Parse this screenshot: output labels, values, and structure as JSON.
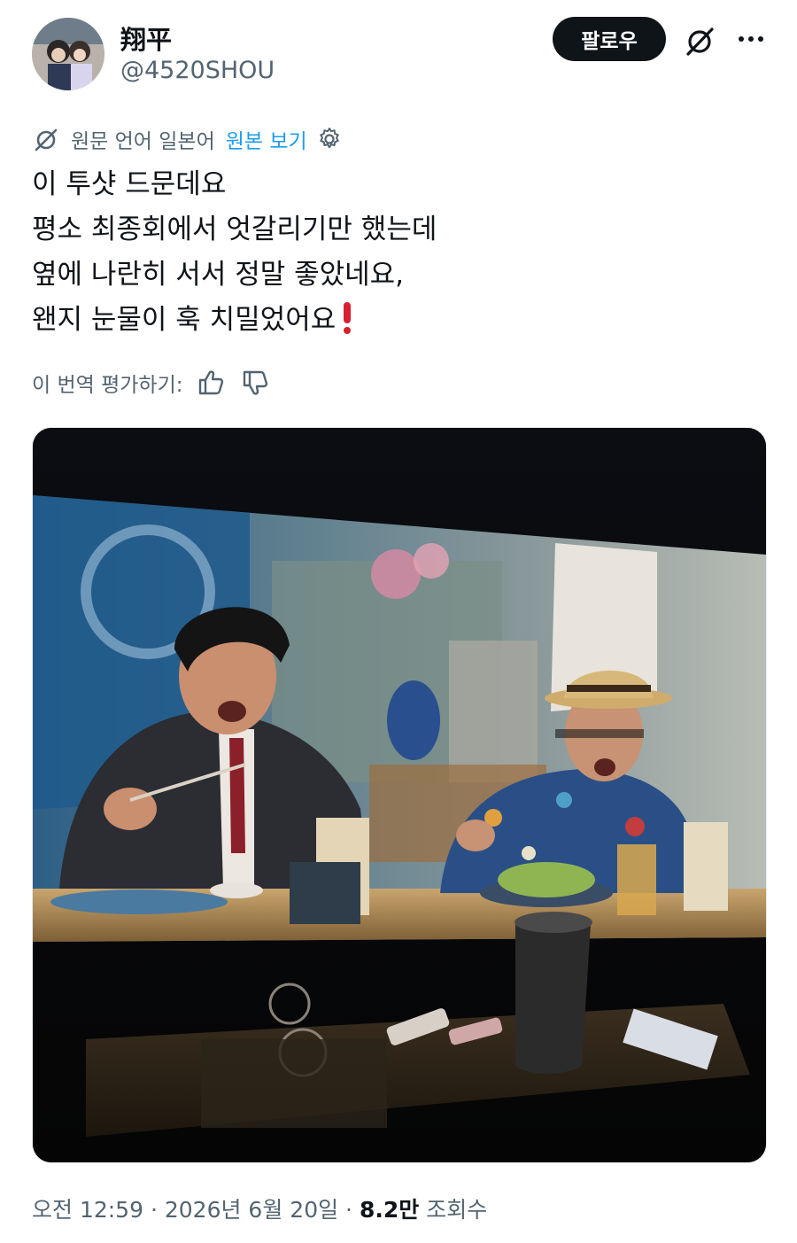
{
  "user": {
    "display_name": "翔平",
    "handle": "@4520SHOU"
  },
  "actions": {
    "follow_label": "팔로우",
    "grok_icon": "grok-slash-icon",
    "more_icon": "more-dots-icon"
  },
  "translation": {
    "source_text": "원문 언어 일본어",
    "show_original": "원본 보기",
    "settings_icon": "gear-icon"
  },
  "tweet": {
    "lines": [
      "이 투샷 드문데요",
      "평소 최종회에서 엇갈리기만 했는데",
      "옆에 나란히 서서 정말 좋았네요,",
      "왠지 눈물이 훅 치밀었어요"
    ],
    "emoji": "red-exclamation-mark"
  },
  "rating": {
    "label": "이 번역 평가하기:",
    "thumbs_up_icon": "thumbs-up-icon",
    "thumbs_down_icon": "thumbs-down-icon"
  },
  "meta": {
    "time": "오전 12:59",
    "separator": "·",
    "date": "2026년 6월 20일",
    "views_count": "8.2만",
    "views_label": "조회수"
  },
  "colors": {
    "text": "#0f1419",
    "secondary": "#536471",
    "link": "#1d9bf0",
    "button_bg": "#0f1419",
    "emoji_red": "#d71f2d"
  }
}
